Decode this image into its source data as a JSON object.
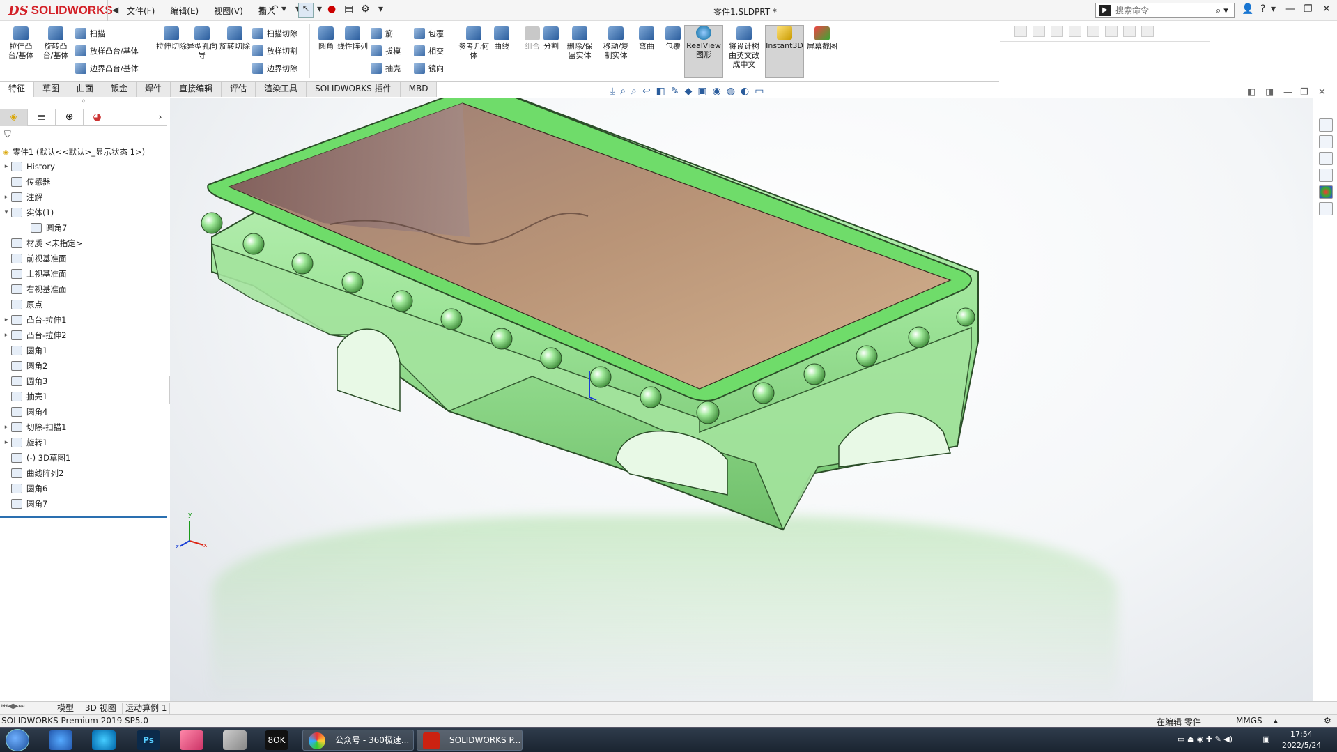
{
  "titlebar": {
    "brand_ds": "DS",
    "brand_name": "SOLIDWORKS",
    "menus": [
      "文件(F)",
      "编辑(E)",
      "视图(V)",
      "插入"
    ],
    "document_title": "零件1.SLDPRT *",
    "search_placeholder": "搜索命令"
  },
  "ribbon": {
    "large_buttons": [
      "拉伸凸台/基体",
      "旋转凸台/基体",
      "拉伸切除",
      "异型孔向导",
      "旋转切除",
      "圆角",
      "线性阵列",
      "参考几何体",
      "曲线",
      "组合",
      "分割",
      "删除/保留实体",
      "移动/复制实体",
      "弯曲",
      "包覆",
      "RealView图形",
      "将设计树由英文改成中文",
      "Instant3D",
      "屏幕截图"
    ],
    "small_buttons": [
      "扫描",
      "放样凸台/基体",
      "边界凸台/基体",
      "扫描切除",
      "放样切割",
      "边界切除",
      "筋",
      "拔模",
      "抽壳",
      "包覆",
      "相交",
      "镜向"
    ]
  },
  "tabs": [
    "特征",
    "草图",
    "曲面",
    "钣金",
    "焊件",
    "直接编辑",
    "评估",
    "渲染工具",
    "SOLIDWORKS 插件",
    "MBD"
  ],
  "tabs_active": "特征",
  "feature_tree": {
    "root": "零件1 (默认<<默认>_显示状态 1>)",
    "nodes": [
      {
        "label": "History",
        "arrow": "▸"
      },
      {
        "label": "传感器",
        "arrow": ""
      },
      {
        "label": "注解",
        "arrow": "▸"
      },
      {
        "label": "实体(1)",
        "arrow": "▾"
      },
      {
        "label": "圆角7",
        "arrow": "",
        "sub": true
      },
      {
        "label": "材质 <未指定>",
        "arrow": ""
      },
      {
        "label": "前视基准面",
        "arrow": ""
      },
      {
        "label": "上视基准面",
        "arrow": ""
      },
      {
        "label": "右视基准面",
        "arrow": ""
      },
      {
        "label": "原点",
        "arrow": ""
      },
      {
        "label": "凸台-拉伸1",
        "arrow": "▸"
      },
      {
        "label": "凸台-拉伸2",
        "arrow": "▸"
      },
      {
        "label": "圆角1",
        "arrow": ""
      },
      {
        "label": "圆角2",
        "arrow": ""
      },
      {
        "label": "圆角3",
        "arrow": ""
      },
      {
        "label": "抽壳1",
        "arrow": ""
      },
      {
        "label": "圆角4",
        "arrow": ""
      },
      {
        "label": "切除-扫描1",
        "arrow": "▸"
      },
      {
        "label": "旋转1",
        "arrow": "▸"
      },
      {
        "label": "(-) 3D草图1",
        "arrow": ""
      },
      {
        "label": "曲线阵列2",
        "arrow": ""
      },
      {
        "label": "圆角6",
        "arrow": ""
      },
      {
        "label": "圆角7",
        "arrow": ""
      }
    ]
  },
  "triad": {
    "y": "y",
    "x": "x",
    "z": "z"
  },
  "model_colors": {
    "body": "#9fe59a",
    "rim": "#6fdc6a",
    "cavity": "#b99477",
    "wall": "#8f6f68"
  },
  "bottom_tabs": [
    "模型",
    "3D 视图",
    "运动算例 1"
  ],
  "status": {
    "product": "SOLIDWORKS Premium 2019 SP5.0",
    "mode": "在编辑 零件",
    "units": "MMGS"
  },
  "taskbar": {
    "tasks": [
      "公众号 - 360极速...",
      "SOLIDWORKS P..."
    ],
    "sw_badge": "2019",
    "time": "17:54",
    "date": "2022/5/24"
  }
}
